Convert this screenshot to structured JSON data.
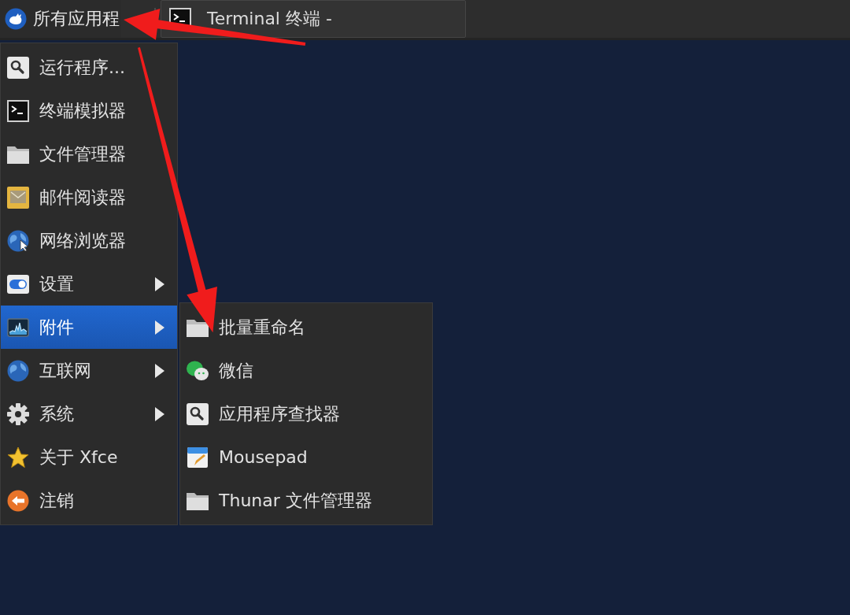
{
  "panel": {
    "apps_button": {
      "label": "所有应用程"
    },
    "tasks": [
      {
        "label": "Terminal 终端 -"
      }
    ]
  },
  "menu": {
    "items": [
      {
        "label": "运行程序...",
        "kind": "launcher",
        "selected": false
      },
      {
        "label": "终端模拟器",
        "kind": "launcher",
        "selected": false
      },
      {
        "label": "文件管理器",
        "kind": "launcher",
        "selected": false
      },
      {
        "label": "邮件阅读器",
        "kind": "launcher",
        "selected": false
      },
      {
        "label": "网络浏览器",
        "kind": "launcher",
        "selected": false
      },
      {
        "label": "设置",
        "kind": "submenu",
        "selected": false
      },
      {
        "label": "附件",
        "kind": "submenu",
        "selected": true
      },
      {
        "label": "互联网",
        "kind": "submenu",
        "selected": false
      },
      {
        "label": "系统",
        "kind": "submenu",
        "selected": false
      },
      {
        "label": "关于 Xfce",
        "kind": "launcher",
        "selected": false
      },
      {
        "label": "注销",
        "kind": "launcher",
        "selected": false
      }
    ]
  },
  "submenu": {
    "items": [
      {
        "label": "批量重命名",
        "selected": false
      },
      {
        "label": "微信",
        "selected": false
      },
      {
        "label": "应用程序查找器",
        "selected": false
      },
      {
        "label": "Mousepad",
        "selected": false
      },
      {
        "label": "Thunar 文件管理器",
        "selected": false
      }
    ]
  }
}
